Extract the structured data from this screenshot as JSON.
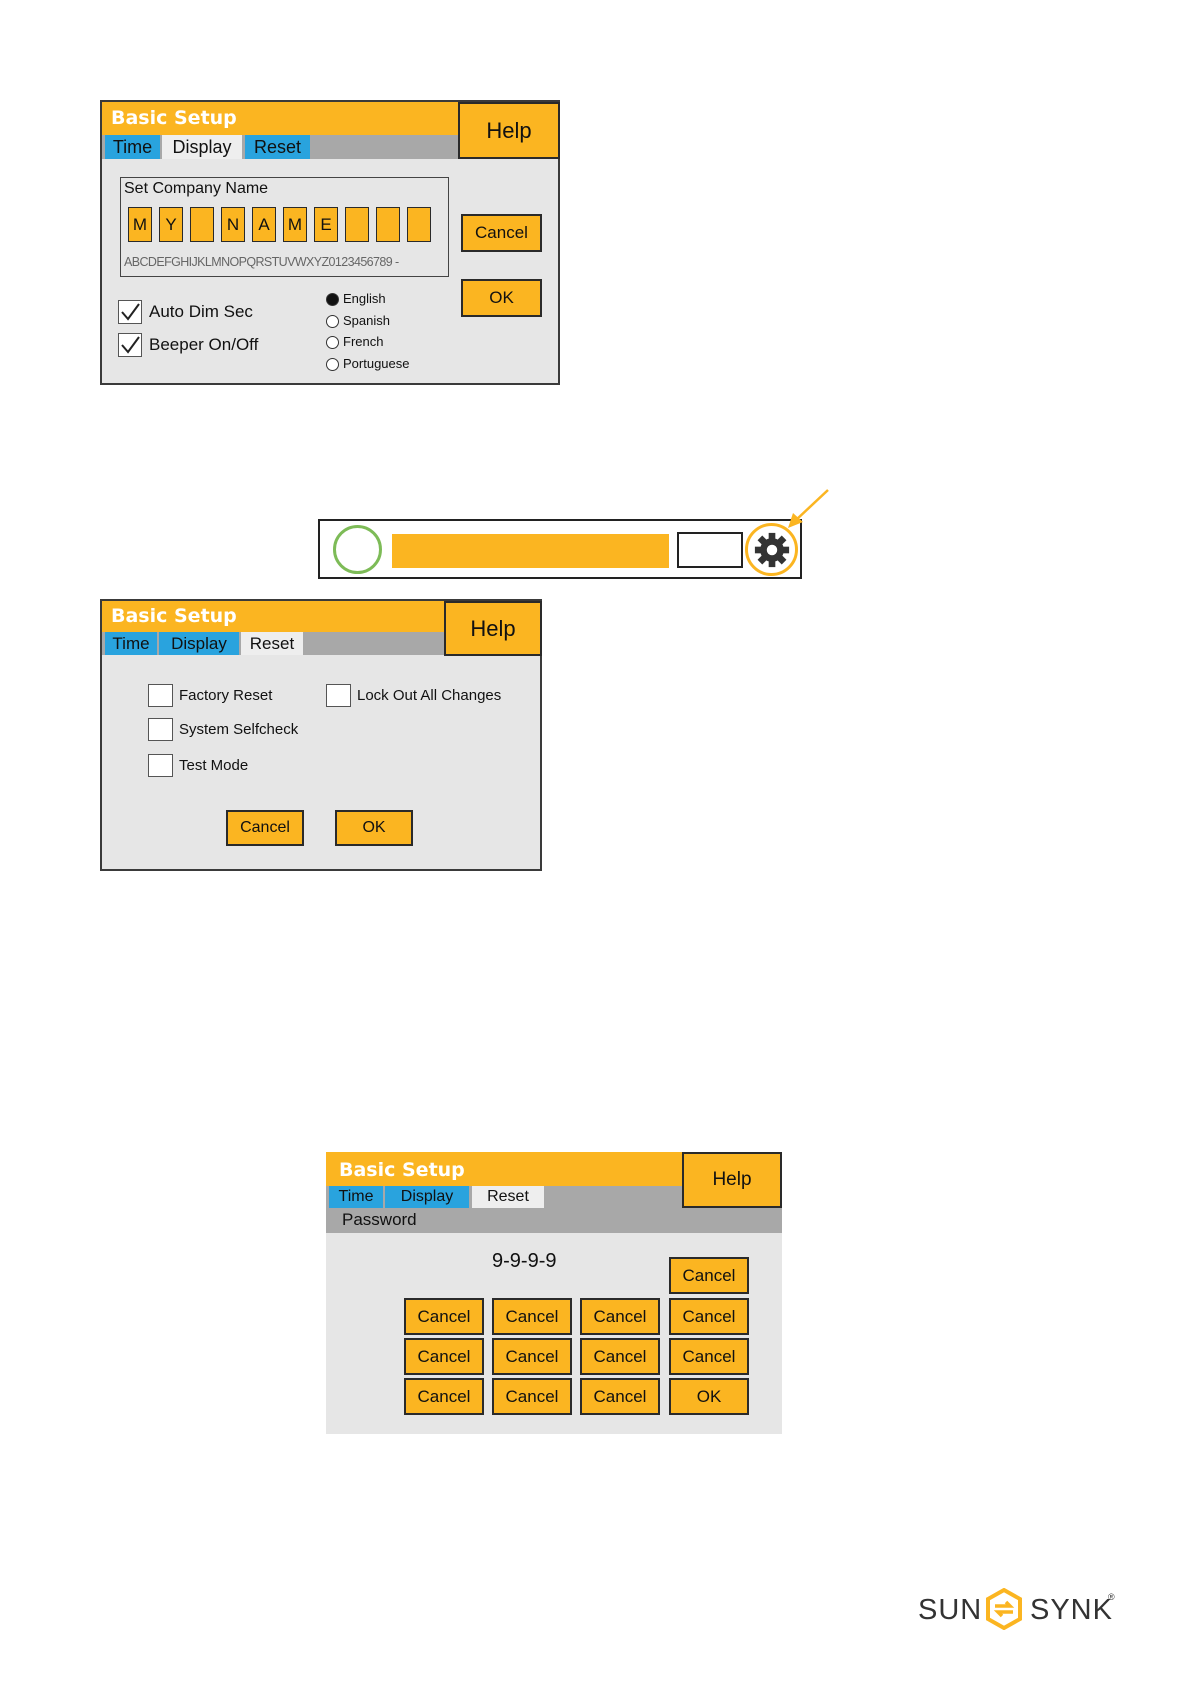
{
  "screen1": {
    "title": "Basic Setup",
    "tabs": [
      "Time",
      "Display",
      "Reset"
    ],
    "help": "Help",
    "company_label": "Set Company Name",
    "name_cells": [
      "M",
      "Y",
      "",
      "N",
      "A",
      "M",
      "E",
      "",
      "",
      ""
    ],
    "alphabet": "ABCDEFGHIJKLMNOPQRSTUVWXYZ0123456789 -",
    "checks": [
      {
        "label": "Auto Dim Sec",
        "checked": true
      },
      {
        "label": "Beeper On/Off",
        "checked": true
      }
    ],
    "languages": [
      {
        "label": "English",
        "selected": true
      },
      {
        "label": "Spanish",
        "selected": false
      },
      {
        "label": "French",
        "selected": false
      },
      {
        "label": "Portuguese",
        "selected": false
      }
    ],
    "cancel": "Cancel",
    "ok": "OK"
  },
  "status_bar": {
    "icons": [
      "status-circle-icon",
      "gear-icon",
      "arrow-icon"
    ],
    "colors": {
      "circle": "#7dbb57",
      "bar": "#fbb521",
      "highlight": "#fbb521"
    }
  },
  "screen2": {
    "title": "Basic Setup",
    "tabs": [
      "Time",
      "Display",
      "Reset"
    ],
    "help": "Help",
    "options_left": [
      "Factory Reset",
      "System Selfcheck",
      "Test Mode"
    ],
    "options_right": [
      "Lock Out All Changes"
    ],
    "cancel": "Cancel",
    "ok": "OK"
  },
  "screen3": {
    "title": "Basic Setup",
    "tabs": [
      "Time",
      "Display",
      "Reset"
    ],
    "help": "Help",
    "password_label": "Password",
    "password_value": "9-9-9-9",
    "top_cancel": "Cancel",
    "keypad": [
      [
        "Cancel",
        "Cancel",
        "Cancel",
        "Cancel"
      ],
      [
        "Cancel",
        "Cancel",
        "Cancel",
        "Cancel"
      ],
      [
        "Cancel",
        "Cancel",
        "Cancel",
        "OK"
      ]
    ]
  },
  "brand": {
    "logo_text_left": "SUN",
    "logo_text_right": "SYNK",
    "registered": "®",
    "color": "#fbb521"
  }
}
